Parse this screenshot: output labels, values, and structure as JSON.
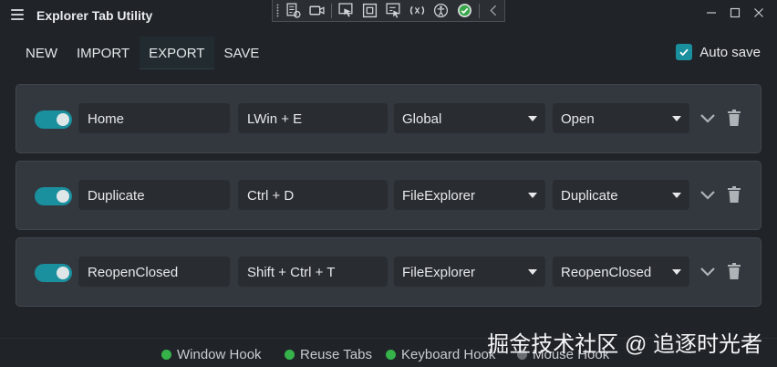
{
  "window": {
    "title": "Explorer Tab Utility",
    "menu_icon": "hamburger-menu-icon",
    "controls": [
      "minimize-icon",
      "maximize-icon",
      "close-icon"
    ]
  },
  "debug_toolbar": {
    "icons": [
      "select-element-icon",
      "video-record-icon",
      "pointer-select-icon",
      "layout-adorners-icon",
      "track-focus-icon",
      "hot-reload-icon",
      "accessibility-icon",
      "binding-check-icon",
      "collapse-chevron-icon"
    ]
  },
  "menu": {
    "new": "NEW",
    "import": "IMPORT",
    "export": "EXPORT",
    "save": "SAVE",
    "autosave_label": "Auto save",
    "autosave_checked": true
  },
  "hotkeys": [
    {
      "enabled": true,
      "name": "Home",
      "keys": "LWin + E",
      "scope": "Global",
      "action": "Open"
    },
    {
      "enabled": true,
      "name": "Duplicate",
      "keys": "Ctrl + D",
      "scope": "FileExplorer",
      "action": "Duplicate"
    },
    {
      "enabled": true,
      "name": "ReopenClosed",
      "keys": "Shift + Ctrl + T",
      "scope": "FileExplorer",
      "action": "ReopenClosed"
    }
  ],
  "status": [
    {
      "label": "Window Hook",
      "color": "#35b24a"
    },
    {
      "label": "Reuse Tabs",
      "color": "#35b24a"
    },
    {
      "label": "Keyboard Hook",
      "color": "#35b24a"
    },
    {
      "label": "Mouse Hook",
      "color": "#6a6e73"
    }
  ],
  "watermark": "掘金技术社区 @ 追逐时光者",
  "colors": {
    "accent": "#1a8f9e",
    "background": "#202429",
    "card": "#33383e",
    "status_on": "#35b24a",
    "status_off": "#6a6e73"
  }
}
